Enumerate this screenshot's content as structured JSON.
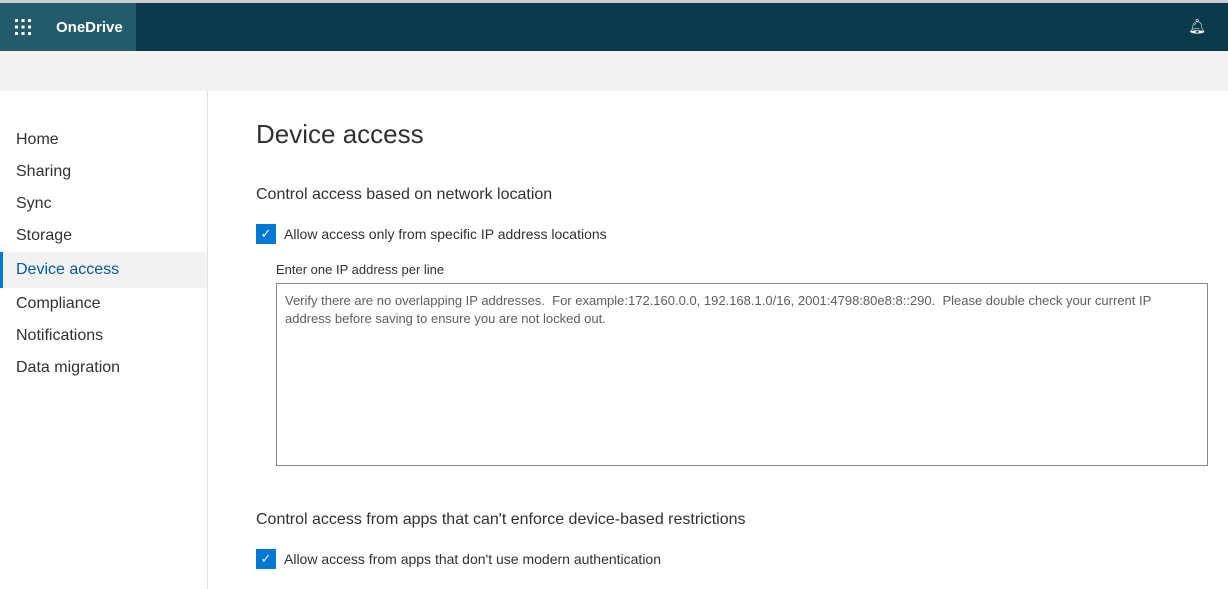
{
  "header": {
    "app_name": "OneDrive",
    "icons": [
      "waffle-icon",
      "bell-icon"
    ]
  },
  "sidebar": {
    "items": [
      {
        "label": "Home"
      },
      {
        "label": "Sharing"
      },
      {
        "label": "Sync"
      },
      {
        "label": "Storage"
      },
      {
        "label": "Device access",
        "active": true
      },
      {
        "label": "Compliance"
      },
      {
        "label": "Notifications"
      },
      {
        "label": "Data migration"
      }
    ]
  },
  "main": {
    "title": "Device access",
    "section1": {
      "heading": "Control access based on network location",
      "checkbox_label": "Allow access only from specific IP address locations",
      "checked": true,
      "field_label": "Enter one IP address per line",
      "field_value": "",
      "placeholder": "Verify there are no overlapping IP addresses.  For example:172.160.0.0, 192.168.1.0/16, 2001:4798:80e8:8::290.  Please double check your current IP address before saving to ensure you are not locked out."
    },
    "section2": {
      "heading": "Control access from apps that can't enforce device-based restrictions",
      "checkbox_label": "Allow access from apps that don't use modern authentication",
      "checked": true
    }
  },
  "colors": {
    "accent": "#0078d4",
    "header": "#0b3a4d"
  }
}
